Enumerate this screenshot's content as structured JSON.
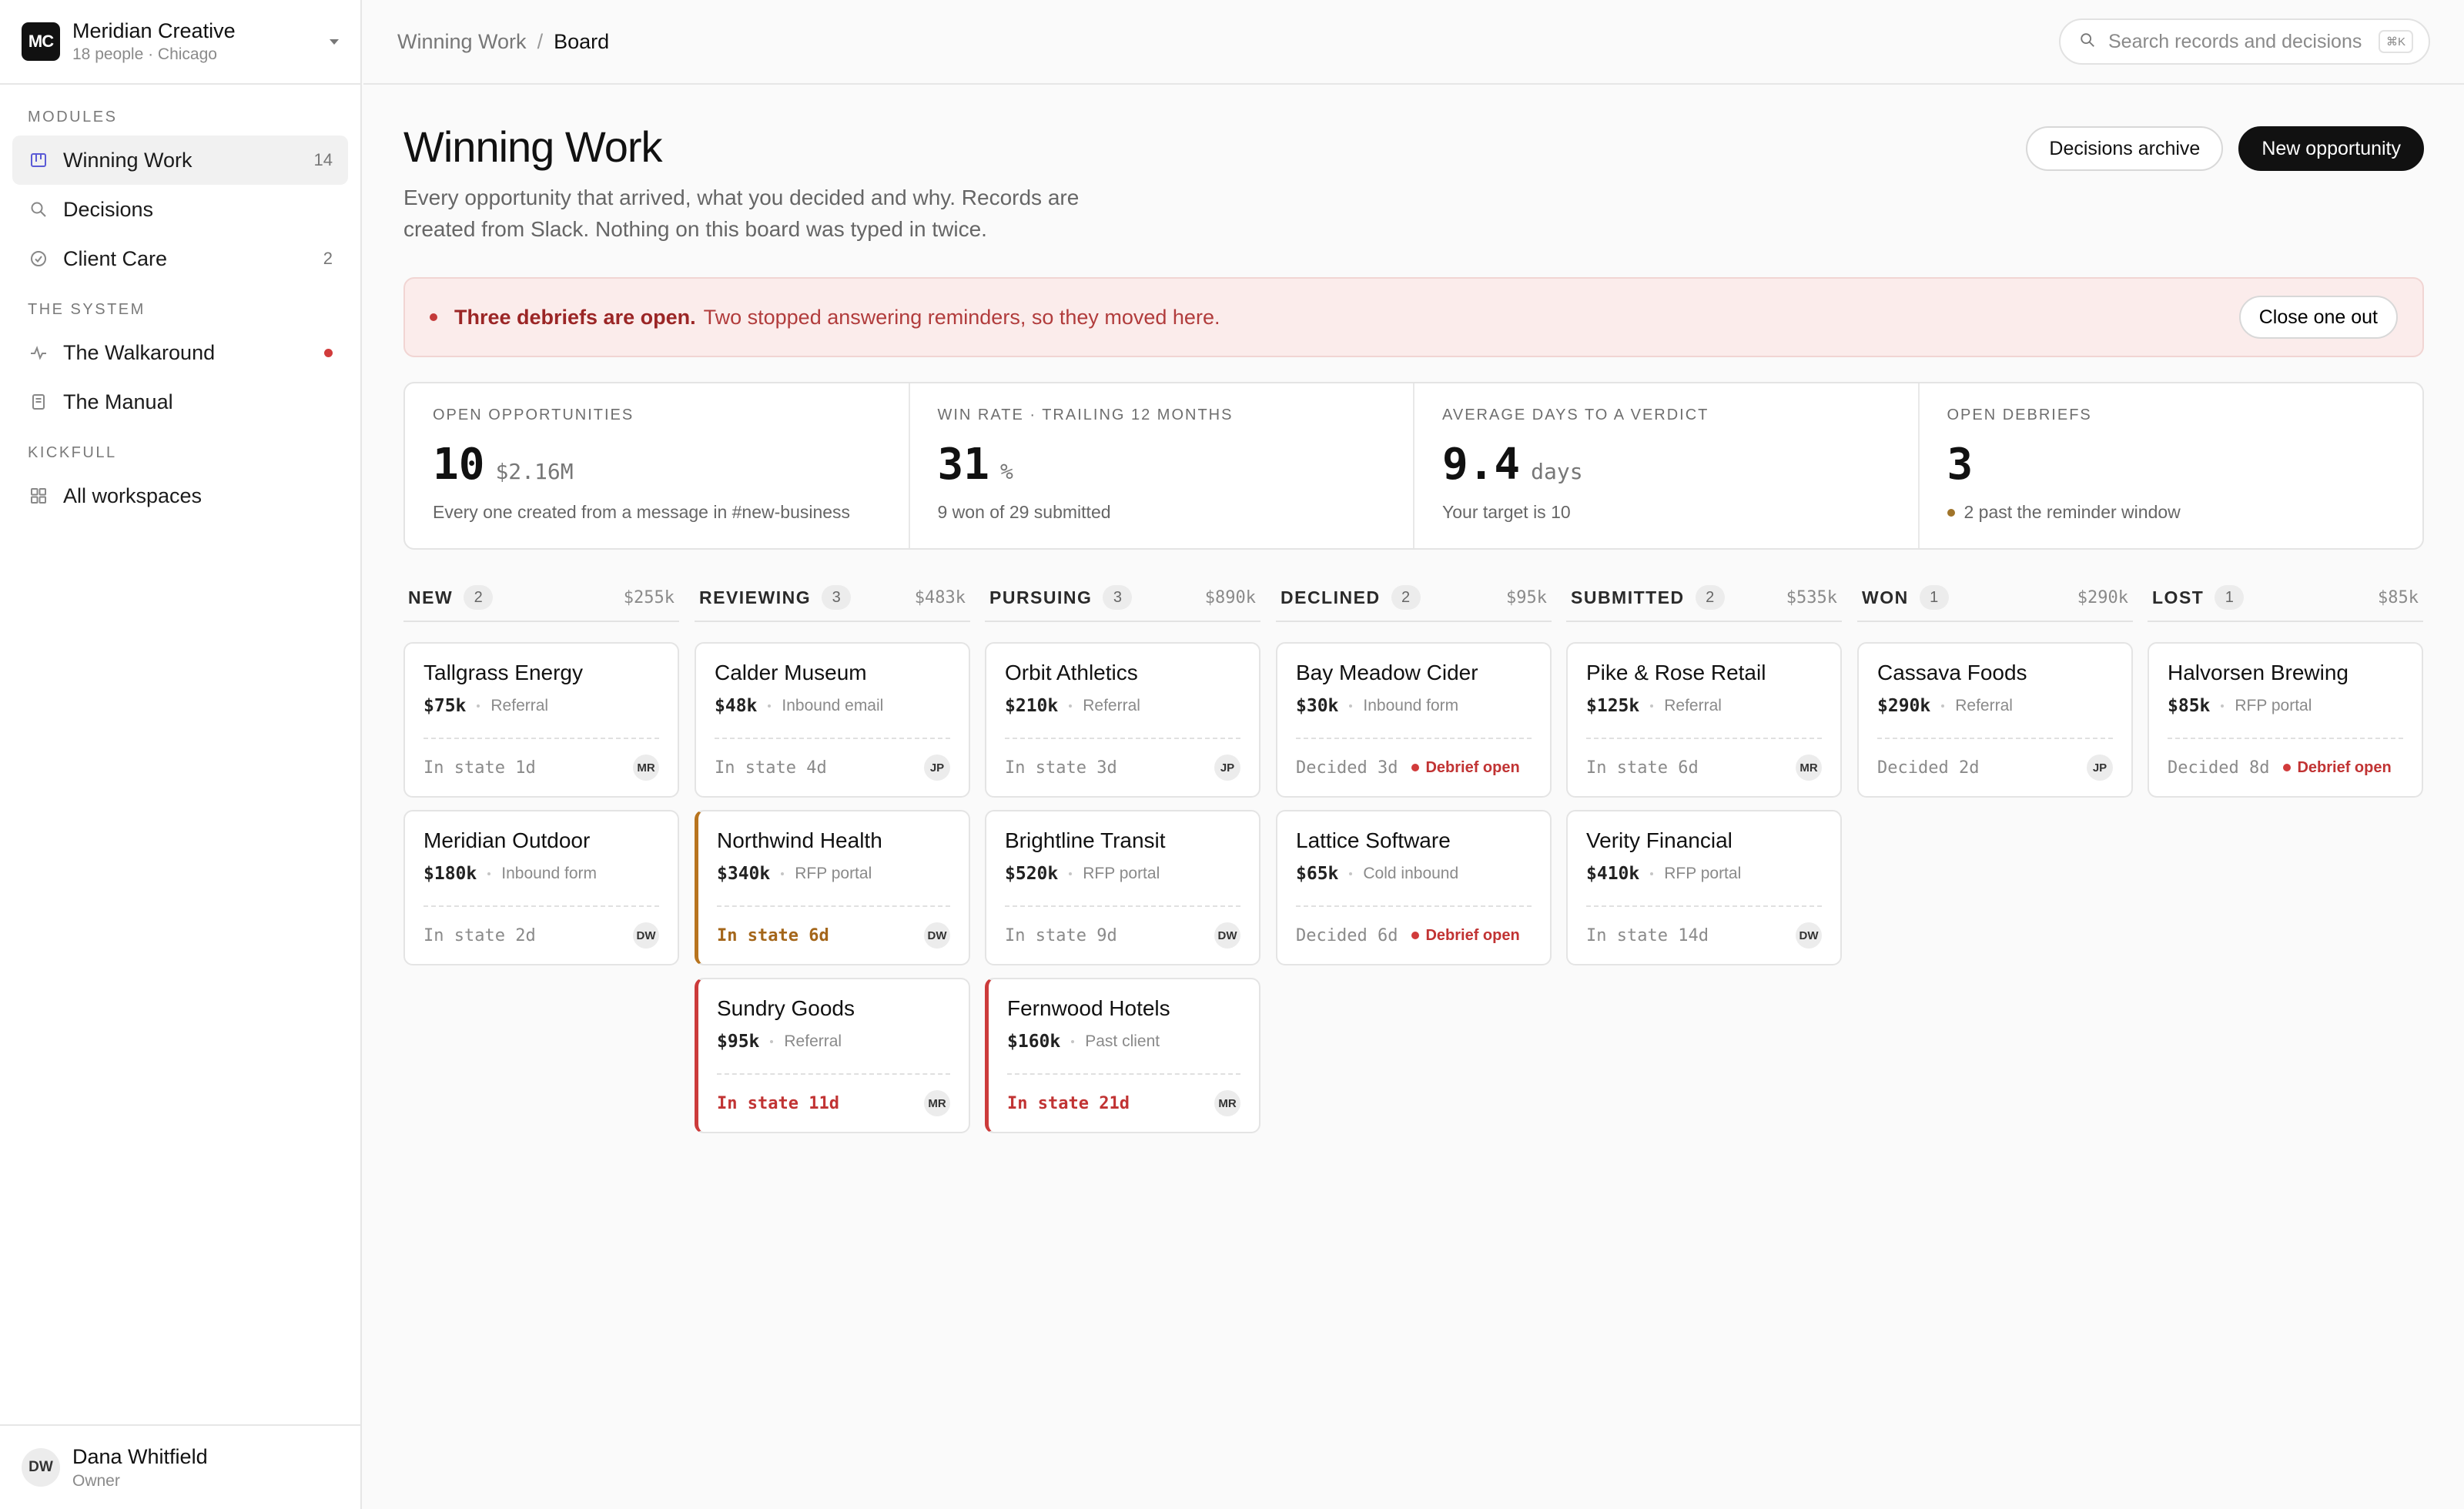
{
  "workspace": {
    "initials": "MC",
    "name": "Meridian Creative",
    "subtitle": "18 people · Chicago"
  },
  "sidebar": {
    "modules_label": "MODULES",
    "modules": [
      {
        "label": "Winning Work",
        "count": "14",
        "icon": "board-icon"
      },
      {
        "label": "Decisions",
        "count": "",
        "icon": "search-icon"
      },
      {
        "label": "Client Care",
        "count": "2",
        "icon": "check-circle-icon"
      }
    ],
    "system_label": "THE SYSTEM",
    "system": [
      {
        "label": "The Walkaround",
        "icon": "pulse-icon",
        "alert": true
      },
      {
        "label": "The Manual",
        "icon": "document-icon"
      }
    ],
    "kickfull_label": "KICKFULL",
    "kickfull": [
      {
        "label": "All workspaces",
        "icon": "grid-icon"
      }
    ]
  },
  "user": {
    "initials": "DW",
    "name": "Dana Whitfield",
    "role": "Owner"
  },
  "topbar": {
    "breadcrumb_parent": "Winning Work",
    "breadcrumb_sep": "/",
    "breadcrumb_current": "Board",
    "search_placeholder": "Search records and decisions",
    "search_shortcut": "⌘K"
  },
  "page": {
    "title": "Winning Work",
    "subtitle": "Every opportunity that arrived, what you decided and why. Records are created from Slack. Nothing on this board was typed in twice.",
    "archive_button": "Decisions archive",
    "new_button": "New opportunity"
  },
  "alert": {
    "strong": "Three debriefs are open.",
    "text": "Two stopped answering reminders, so they moved here.",
    "button": "Close one out"
  },
  "stats": [
    {
      "label": "OPEN OPPORTUNITIES",
      "value": "10",
      "unit": "$2.16M",
      "note": "Every one created from a message in #new-business",
      "note_dot": false
    },
    {
      "label": "WIN RATE · TRAILING 12 MONTHS",
      "value": "31",
      "unit": "%",
      "note": "9 won of 29 submitted",
      "note_dot": false
    },
    {
      "label": "AVERAGE DAYS TO A VERDICT",
      "value": "9.4",
      "unit": "days",
      "note": "Your target is 10",
      "note_dot": false
    },
    {
      "label": "OPEN DEBRIEFS",
      "value": "3",
      "unit": "",
      "note": "2 past the reminder window",
      "note_dot": true
    }
  ],
  "columns": [
    {
      "name": "NEW",
      "count": "2",
      "total": "$255k",
      "cards": [
        {
          "title": "Tallgrass Energy",
          "amount": "$75k",
          "source": "Referral",
          "state": "In state 1d",
          "tone": "normal",
          "debrief": "",
          "owner": "MR"
        },
        {
          "title": "Meridian Outdoor",
          "amount": "$180k",
          "source": "Inbound form",
          "state": "In state 2d",
          "tone": "normal",
          "debrief": "",
          "owner": "DW"
        }
      ]
    },
    {
      "name": "REVIEWING",
      "count": "3",
      "total": "$483k",
      "cards": [
        {
          "title": "Calder Museum",
          "amount": "$48k",
          "source": "Inbound email",
          "state": "In state 4d",
          "tone": "normal",
          "debrief": "",
          "owner": "JP"
        },
        {
          "title": "Northwind Health",
          "amount": "$340k",
          "source": "RFP portal",
          "state": "In state 6d",
          "tone": "amber",
          "debrief": "",
          "owner": "DW"
        },
        {
          "title": "Sundry Goods",
          "amount": "$95k",
          "source": "Referral",
          "state": "In state 11d",
          "tone": "red",
          "debrief": "",
          "owner": "MR"
        }
      ]
    },
    {
      "name": "PURSUING",
      "count": "3",
      "total": "$890k",
      "cards": [
        {
          "title": "Orbit Athletics",
          "amount": "$210k",
          "source": "Referral",
          "state": "In state 3d",
          "tone": "normal",
          "debrief": "",
          "owner": "JP"
        },
        {
          "title": "Brightline Transit",
          "amount": "$520k",
          "source": "RFP portal",
          "state": "In state 9d",
          "tone": "normal",
          "debrief": "",
          "owner": "DW"
        },
        {
          "title": "Fernwood Hotels",
          "amount": "$160k",
          "source": "Past client",
          "state": "In state 21d",
          "tone": "red",
          "debrief": "",
          "owner": "MR"
        }
      ]
    },
    {
      "name": "DECLINED",
      "count": "2",
      "total": "$95k",
      "cards": [
        {
          "title": "Bay Meadow Cider",
          "amount": "$30k",
          "source": "Inbound form",
          "state": "Decided 3d",
          "tone": "normal",
          "debrief": "Debrief open",
          "owner": ""
        },
        {
          "title": "Lattice Software",
          "amount": "$65k",
          "source": "Cold inbound",
          "state": "Decided 6d",
          "tone": "normal",
          "debrief": "Debrief open",
          "owner": ""
        }
      ]
    },
    {
      "name": "SUBMITTED",
      "count": "2",
      "total": "$535k",
      "cards": [
        {
          "title": "Pike & Rose Retail",
          "amount": "$125k",
          "source": "Referral",
          "state": "In state 6d",
          "tone": "normal",
          "debrief": "",
          "owner": "MR"
        },
        {
          "title": "Verity Financial",
          "amount": "$410k",
          "source": "RFP portal",
          "state": "In state 14d",
          "tone": "normal",
          "debrief": "",
          "owner": "DW"
        }
      ]
    },
    {
      "name": "WON",
      "count": "1",
      "total": "$290k",
      "cards": [
        {
          "title": "Cassava Foods",
          "amount": "$290k",
          "source": "Referral",
          "state": "Decided 2d",
          "tone": "normal",
          "debrief": "",
          "owner": "JP"
        }
      ]
    },
    {
      "name": "LOST",
      "count": "1",
      "total": "$85k",
      "cards": [
        {
          "title": "Halvorsen Brewing",
          "amount": "$85k",
          "source": "RFP portal",
          "state": "Decided 8d",
          "tone": "normal",
          "debrief": "Debrief open",
          "owner": ""
        }
      ]
    }
  ]
}
